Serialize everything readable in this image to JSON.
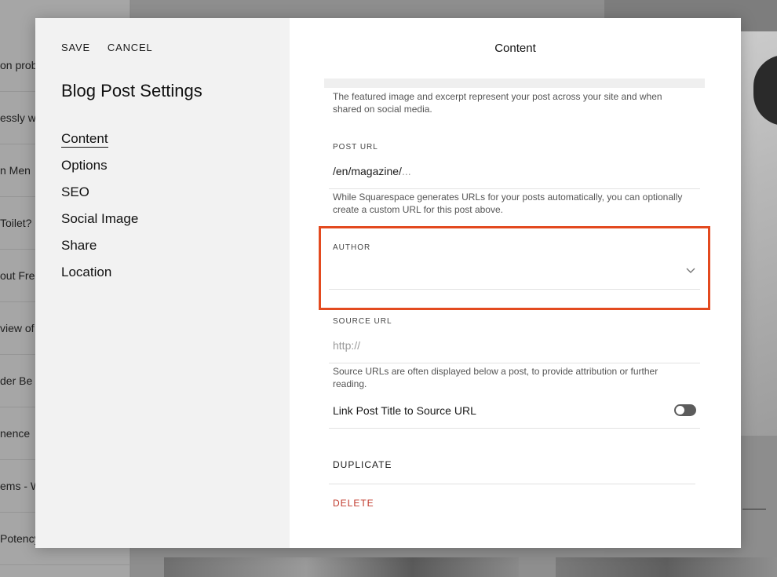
{
  "background": {
    "list_items": [
      "on prob",
      "essly w",
      "n Men",
      "Toilet?",
      "out Fre",
      "view of",
      "der Be",
      "nence",
      "ems - W",
      "Potency"
    ]
  },
  "sidebar": {
    "save_label": "SAVE",
    "cancel_label": "CANCEL",
    "title": "Blog Post Settings",
    "nav": [
      {
        "label": "Content",
        "active": true
      },
      {
        "label": "Options"
      },
      {
        "label": "SEO"
      },
      {
        "label": "Social Image"
      },
      {
        "label": "Share"
      },
      {
        "label": "Location"
      }
    ]
  },
  "content": {
    "title": "Content",
    "featured_help": "The featured image and excerpt represent your post across your site and when shared on social media.",
    "post_url": {
      "label": "POST URL",
      "value": "/en/magazine/",
      "ellipsis": "...",
      "help": "While Squarespace generates URLs for your posts automatically, you can optionally create a custom URL for this post above."
    },
    "author": {
      "label": "AUTHOR",
      "value": "",
      "highlight_color": "#e34a1f"
    },
    "source_url": {
      "label": "SOURCE URL",
      "placeholder": "http://",
      "help": "Source URLs are often displayed below a post, to provide attribution or further reading."
    },
    "link_toggle": {
      "label": "Link Post Title to Source URL",
      "on": false
    },
    "duplicate_label": "DUPLICATE",
    "delete_label": "DELETE",
    "delete_color": "#c0392b"
  }
}
